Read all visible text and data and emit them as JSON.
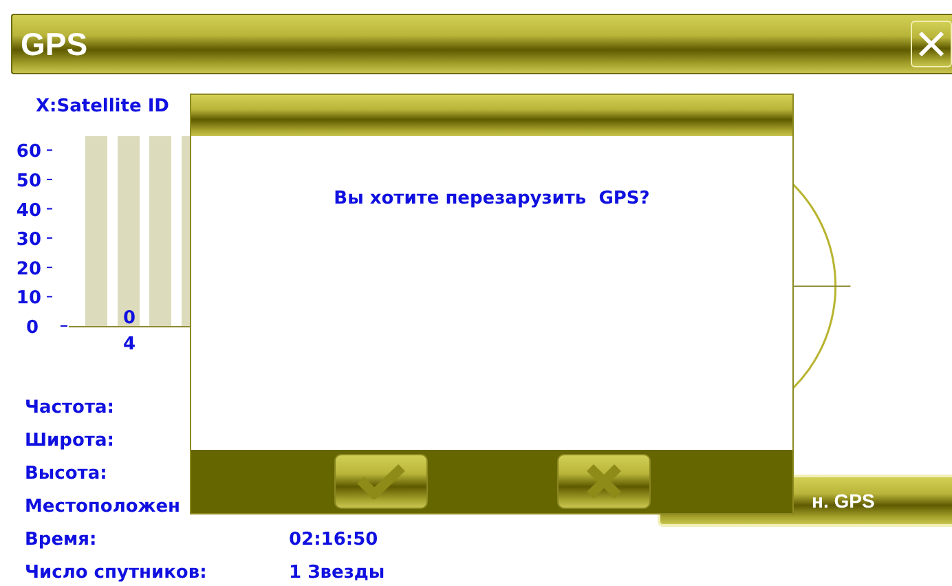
{
  "window": {
    "title": "GPS"
  },
  "chart": {
    "label": "X:Satellite ID",
    "chart_data": {
      "type": "bar",
      "categories": [
        "4"
      ],
      "values": [
        0
      ],
      "ylim": [
        0,
        65
      ],
      "yticks": [
        0,
        10,
        20,
        30,
        40,
        50,
        60
      ],
      "data_labels": true
    }
  },
  "info": [
    {
      "label": "Частота:"
    },
    {
      "label": "Широта:"
    },
    {
      "label": "Высота:"
    },
    {
      "label": "Местоположен"
    },
    {
      "label": "Время:",
      "value": "02:16:50"
    },
    {
      "label": "Число спутников:",
      "value": "1 Звезды"
    }
  ],
  "bottom_button": {
    "label": "н. GPS"
  },
  "dialog": {
    "message": "Вы хотите перезарузить  GPS?",
    "buttons": [
      {
        "kind": "ok"
      },
      {
        "kind": "cancel"
      }
    ]
  }
}
